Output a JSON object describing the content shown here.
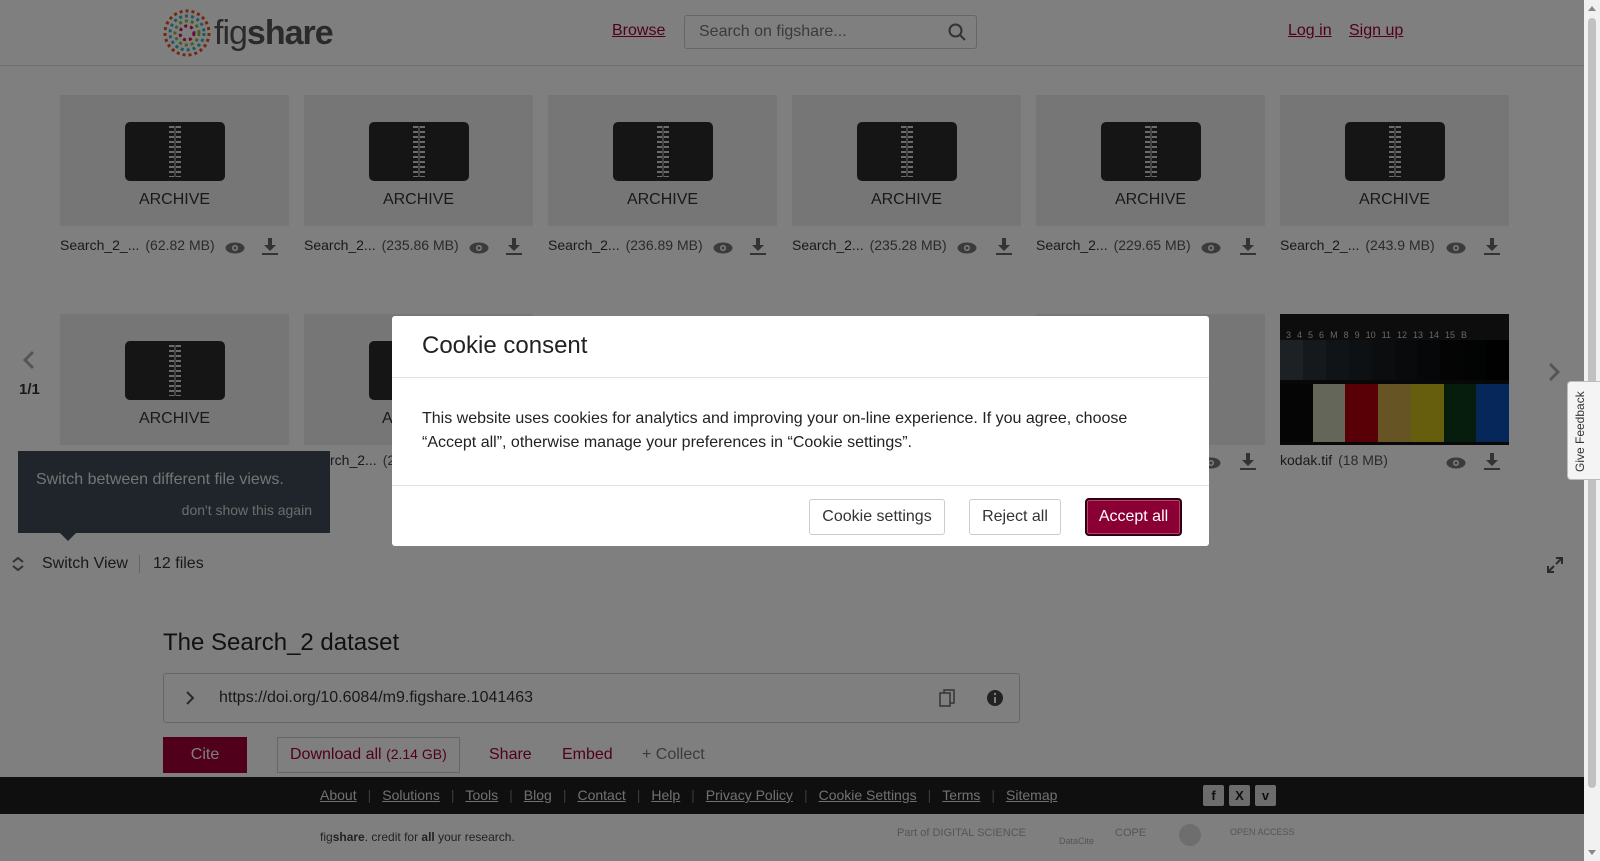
{
  "header": {
    "logo_text_light": "fig",
    "logo_text_bold": "share",
    "browse": "Browse",
    "search_placeholder": "Search on figshare...",
    "login": "Log in",
    "signup": "Sign up"
  },
  "viewer": {
    "files_row1": [
      {
        "type": "ARCHIVE",
        "name": "Search_2_...",
        "size": "(62.82 MB)"
      },
      {
        "type": "ARCHIVE",
        "name": "Search_2...",
        "size": "(235.86 MB)"
      },
      {
        "type": "ARCHIVE",
        "name": "Search_2...",
        "size": "(236.89 MB)"
      },
      {
        "type": "ARCHIVE",
        "name": "Search_2...",
        "size": "(235.28 MB)"
      },
      {
        "type": "ARCHIVE",
        "name": "Search_2...",
        "size": "(229.65 MB)"
      },
      {
        "type": "ARCHIVE",
        "name": "Search_2_...",
        "size": "(243.9 MB)"
      }
    ],
    "files_row2": [
      {
        "type": "ARCHIVE"
      },
      {
        "type": "A",
        "name": "rch_2...",
        "size": "(2"
      },
      {
        "name": "kodak.tif",
        "size": "(18 MB)"
      }
    ],
    "kodak_ruler": [
      "3",
      "4",
      "5",
      "6",
      "M",
      "8",
      "9",
      "10",
      "11",
      "12",
      "13",
      "14",
      "15",
      "B"
    ],
    "pager": "1/1",
    "tooltip": {
      "text": "Switch between different file views.",
      "dismiss": "don't show this again"
    },
    "switch_view": "Switch View",
    "file_count": "12 files"
  },
  "dataset": {
    "title": "The Search_2 dataset",
    "doi": "https://doi.org/10.6084/m9.figshare.1041463",
    "cite": "Cite",
    "download_all": "Download all",
    "download_size": "(2.14 GB)",
    "share": "Share",
    "embed": "Embed",
    "collect": "+ Collect"
  },
  "footer": {
    "links": [
      "About",
      "Solutions",
      "Tools",
      "Blog",
      "Contact",
      "Help",
      "Privacy Policy",
      "Cookie Settings",
      "Terms",
      "Sitemap"
    ],
    "social": [
      "f",
      "X",
      "v"
    ],
    "tagline_pre": "fig",
    "tagline_bold": "share",
    "tagline_mid": ". credit for ",
    "tagline_all": "all",
    "tagline_end": " your research.",
    "partners": [
      "Part of DIGITAL SCIENCE",
      "DataCite",
      "COPE",
      "",
      "OPEN ACCESS"
    ]
  },
  "feedback": "Give Feedback",
  "cookie_modal": {
    "title": "Cookie consent",
    "body": "This website uses cookies for analytics and improving your on-line experience. If you agree, choose “Accept all”, otherwise manage your preferences in “Cookie settings”.",
    "settings": "Cookie settings",
    "reject": "Reject all",
    "accept": "Accept all"
  },
  "colors": {
    "brand": "#a00037",
    "accept_bg": "#8a0034",
    "footer_bg": "#1e1e1e",
    "overlay": "rgba(0,0,0,0.5)"
  }
}
